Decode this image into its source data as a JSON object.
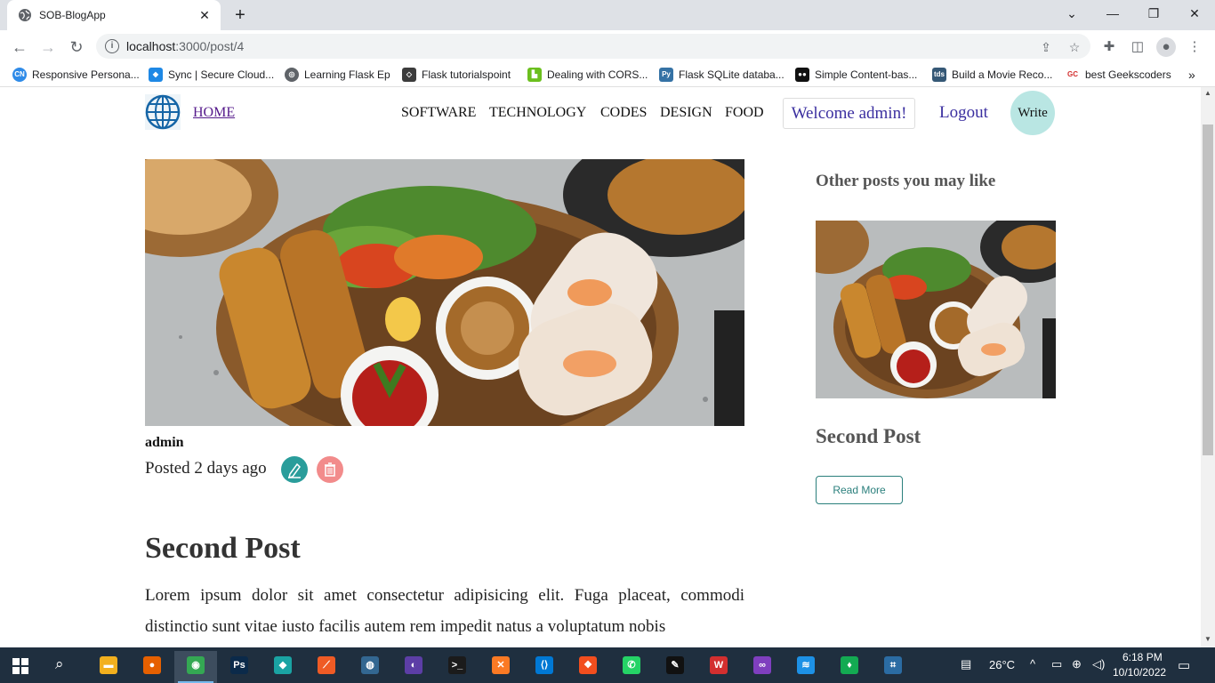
{
  "browser": {
    "tab_title": "SOB-BlogApp",
    "url_host": "localhost",
    "url_rest": ":3000/post/4"
  },
  "bookmarks": [
    {
      "label": "Responsive Persona...",
      "icon": "cn-icon",
      "color": "#2f8be8",
      "glyph": "CN"
    },
    {
      "label": "Sync | Secure Cloud...",
      "icon": "sync-icon",
      "color": "#1e88e5",
      "glyph": "◆"
    },
    {
      "label": "Learning Flask Ep",
      "icon": "globe-icon",
      "color": "#5f6368",
      "glyph": "◎"
    },
    {
      "label": "Flask tutorialspoint",
      "icon": "tutorialspoint-icon",
      "color": "#3c3c3c",
      "glyph": "◇"
    },
    {
      "label": "Dealing with CORS...",
      "icon": "stair-icon",
      "color": "#6bbf1e",
      "glyph": "▙"
    },
    {
      "label": "Flask SQLite databa...",
      "icon": "python-icon",
      "color": "#3572a5",
      "glyph": "Py"
    },
    {
      "label": "Simple Content-bas...",
      "icon": "medium-icon",
      "color": "#111111",
      "glyph": "●●"
    },
    {
      "label": "Build a Movie Reco...",
      "icon": "tds-icon",
      "color": "#355876",
      "glyph": "tds"
    },
    {
      "label": "best Geekscoders",
      "icon": "gc-icon",
      "color": "#ffffff",
      "glyph": "GC"
    }
  ],
  "nav": {
    "home": "HOME",
    "menu": [
      "SOFTWARE",
      "TECHNOLOGY",
      "CODES",
      "DESIGN",
      "FOOD"
    ],
    "welcome": "Welcome admin!",
    "logout": "Logout",
    "write": "Write"
  },
  "post": {
    "author": "admin",
    "posted": "Posted 2 days ago",
    "title": "Second Post",
    "body": "Lorem ipsum dolor sit amet consectetur adipisicing elit. Fuga placeat, commodi distinctio sunt vitae iusto facilis autem rem impedit natus a voluptatum nobis"
  },
  "sidebar": {
    "heading": "Other posts you may like",
    "post_title": "Second Post",
    "read_more": "Read More"
  },
  "taskbar": {
    "temperature": "26°C",
    "time": "6:18 PM",
    "date": "10/10/2022",
    "apps": [
      {
        "name": "file-explorer",
        "glyph": "▬",
        "color": "#f2b01e"
      },
      {
        "name": "firefox",
        "glyph": "●",
        "color": "#e66000"
      },
      {
        "name": "chrome",
        "glyph": "◉",
        "color": "#34a853"
      },
      {
        "name": "photoshop",
        "glyph": "Ps",
        "color": "#0b2a4a"
      },
      {
        "name": "git-kraken",
        "glyph": "◆",
        "color": "#1aa3a3"
      },
      {
        "name": "postman",
        "glyph": "⟋",
        "color": "#ef5b25"
      },
      {
        "name": "pgadmin",
        "glyph": "◍",
        "color": "#336791"
      },
      {
        "name": "eclipse",
        "glyph": "◐",
        "color": "#5c3ea6"
      },
      {
        "name": "terminal",
        "glyph": ">_",
        "color": "#1b1b1b"
      },
      {
        "name": "xampp",
        "glyph": "✕",
        "color": "#fb7a24"
      },
      {
        "name": "vscode",
        "glyph": "⟨⟩",
        "color": "#0078d4"
      },
      {
        "name": "figma",
        "glyph": "❖",
        "color": "#f24e1e"
      },
      {
        "name": "whatsapp",
        "glyph": "✆",
        "color": "#25d366"
      },
      {
        "name": "inkscape",
        "glyph": "✎",
        "color": "#111111"
      },
      {
        "name": "wps-office",
        "glyph": "W",
        "color": "#d32f2f"
      },
      {
        "name": "visual-studio",
        "glyph": "∞",
        "color": "#7f3fbf"
      },
      {
        "name": "docker",
        "glyph": "≋",
        "color": "#1d91e6"
      },
      {
        "name": "mongodb-compass",
        "glyph": "♦",
        "color": "#13aa52"
      },
      {
        "name": "remote-desktop",
        "glyph": "⌗",
        "color": "#2b6ca3"
      }
    ]
  }
}
